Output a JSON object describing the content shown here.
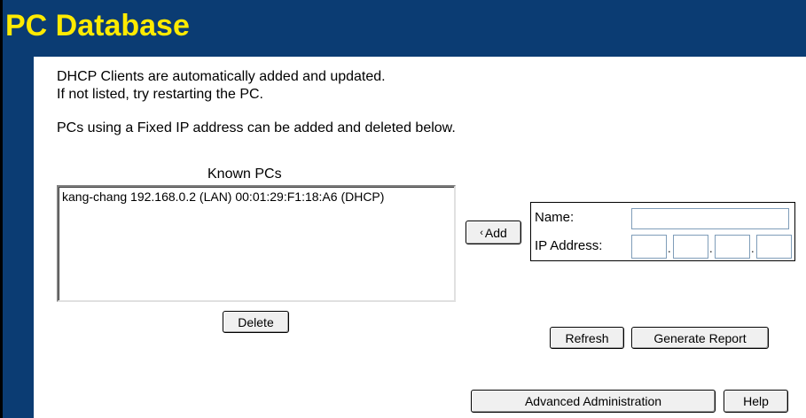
{
  "header": {
    "title": "PC Database"
  },
  "intro": {
    "line1": "DHCP Clients are automatically added and updated.",
    "line2": "If not listed, try restarting the PC.",
    "line3": "PCs using a Fixed IP address can be added and deleted below."
  },
  "known_pcs": {
    "label": "Known PCs",
    "items": [
      "kang-chang 192.168.0.2 (LAN) 00:01:29:F1:18:A6 (DHCP)"
    ],
    "delete_label": "Delete"
  },
  "add_button": {
    "label": "Add",
    "icon": "chevron-left-icon"
  },
  "form": {
    "name_label": "Name:",
    "name_value": "",
    "ip_label": "IP Address:",
    "ip_octets": [
      "",
      "",
      "",
      ""
    ],
    "ip_separator": "."
  },
  "actions": {
    "refresh_label": "Refresh",
    "generate_report_label": "Generate Report",
    "advanced_admin_label": "Advanced Administration",
    "help_label": "Help"
  },
  "colors": {
    "header_bg": "#0b3c73",
    "title": "#ffea00"
  }
}
